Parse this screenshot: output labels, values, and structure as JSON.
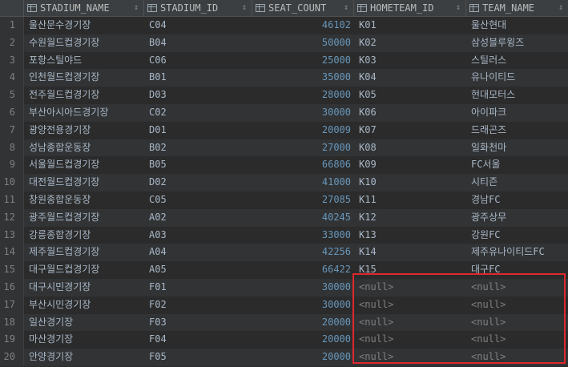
{
  "columns": [
    {
      "label": "STADIUM_NAME",
      "sort": "↕"
    },
    {
      "label": "STADIUM_ID",
      "sort": "↕"
    },
    {
      "label": "SEAT_COUNT",
      "sort": "↕"
    },
    {
      "label": "HOMETEAM_ID",
      "sort": "↕"
    },
    {
      "label": "TEAM_NAME",
      "sort": "↕"
    }
  ],
  "rows": [
    {
      "n": "1",
      "stadium_name": "울산문수경기장",
      "stadium_id": "C04",
      "seat_count": "46102",
      "hometeam_id": "K01",
      "team_name": "울산현대"
    },
    {
      "n": "2",
      "stadium_name": "수원월드컵경기장",
      "stadium_id": "B04",
      "seat_count": "50000",
      "hometeam_id": "K02",
      "team_name": "삼성블루윙즈"
    },
    {
      "n": "3",
      "stadium_name": "포항스틸야드",
      "stadium_id": "C06",
      "seat_count": "25000",
      "hometeam_id": "K03",
      "team_name": "스틸러스"
    },
    {
      "n": "4",
      "stadium_name": "인천월드컵경기장",
      "stadium_id": "B01",
      "seat_count": "35000",
      "hometeam_id": "K04",
      "team_name": "유나이티드"
    },
    {
      "n": "5",
      "stadium_name": "전주월드컵경기장",
      "stadium_id": "D03",
      "seat_count": "28000",
      "hometeam_id": "K05",
      "team_name": "현대모터스"
    },
    {
      "n": "6",
      "stadium_name": "부산아시아드경기장",
      "stadium_id": "C02",
      "seat_count": "30000",
      "hometeam_id": "K06",
      "team_name": "아이파크"
    },
    {
      "n": "7",
      "stadium_name": "광양전용경기장",
      "stadium_id": "D01",
      "seat_count": "20009",
      "hometeam_id": "K07",
      "team_name": "드래곤즈"
    },
    {
      "n": "8",
      "stadium_name": "성남종합운동장",
      "stadium_id": "B02",
      "seat_count": "27000",
      "hometeam_id": "K08",
      "team_name": "일화천마"
    },
    {
      "n": "9",
      "stadium_name": "서울월드컵경기장",
      "stadium_id": "B05",
      "seat_count": "66806",
      "hometeam_id": "K09",
      "team_name": "FC서울"
    },
    {
      "n": "10",
      "stadium_name": "대전월드컵경기장",
      "stadium_id": "D02",
      "seat_count": "41000",
      "hometeam_id": "K10",
      "team_name": "시티즌"
    },
    {
      "n": "11",
      "stadium_name": "창원종합운동장",
      "stadium_id": "C05",
      "seat_count": "27085",
      "hometeam_id": "K11",
      "team_name": "경남FC"
    },
    {
      "n": "12",
      "stadium_name": "광주월드컵경기장",
      "stadium_id": "A02",
      "seat_count": "40245",
      "hometeam_id": "K12",
      "team_name": "광주상무"
    },
    {
      "n": "13",
      "stadium_name": "강릉종합경기장",
      "stadium_id": "A03",
      "seat_count": "33000",
      "hometeam_id": "K13",
      "team_name": "강원FC"
    },
    {
      "n": "14",
      "stadium_name": "제주월드컵경기장",
      "stadium_id": "A04",
      "seat_count": "42256",
      "hometeam_id": "K14",
      "team_name": "제주유나이티드FC"
    },
    {
      "n": "15",
      "stadium_name": "대구월드컵경기장",
      "stadium_id": "A05",
      "seat_count": "66422",
      "hometeam_id": "K15",
      "team_name": "대구FC"
    },
    {
      "n": "16",
      "stadium_name": "대구시민경기장",
      "stadium_id": "F01",
      "seat_count": "30000",
      "hometeam_id": "<null>",
      "team_name": "<null>"
    },
    {
      "n": "17",
      "stadium_name": "부산시민경기장",
      "stadium_id": "F02",
      "seat_count": "30000",
      "hometeam_id": "<null>",
      "team_name": "<null>"
    },
    {
      "n": "18",
      "stadium_name": "일산경기장",
      "stadium_id": "F03",
      "seat_count": "20000",
      "hometeam_id": "<null>",
      "team_name": "<null>"
    },
    {
      "n": "19",
      "stadium_name": "마산경기장",
      "stadium_id": "F04",
      "seat_count": "20000",
      "hometeam_id": "<null>",
      "team_name": "<null>"
    },
    {
      "n": "20",
      "stadium_name": "안양경기장",
      "stadium_id": "F05",
      "seat_count": "20000",
      "hometeam_id": "<null>",
      "team_name": "<null>"
    }
  ],
  "colors": {
    "background": "#2b2b2b",
    "header": "#3c3f41",
    "number": "#6897bb",
    "null_text": "#808080",
    "highlight": "#e0282e"
  },
  "icons": {
    "column_icon": "table-column-icon",
    "sort_icon": "sort-icon"
  }
}
